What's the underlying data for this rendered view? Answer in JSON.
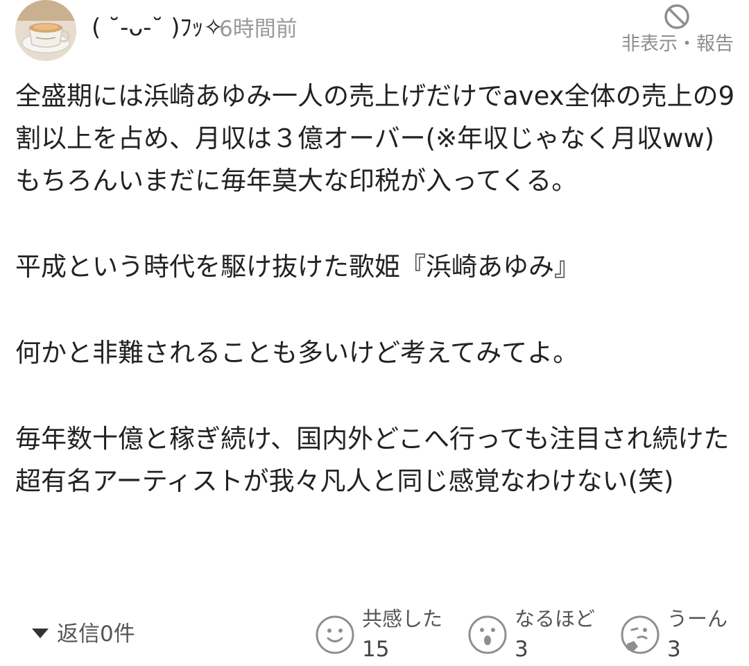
{
  "comment": {
    "user_name": "( ˘-ᴗ-˘ )ﾌｯ✧",
    "timestamp": "6時間前",
    "hide_report_label": "非表示・報告",
    "body_paragraphs": [
      "全盛期には浜崎あゆみ一人の売上げだけでavex全体の売上の9割以上を占め、月収は３億オーバー(※年収じゃなく月収ww) もちろんいまだに毎年莫大な印税が入ってくる。",
      "平成という時代を駆け抜けた歌姫『浜崎あゆみ』",
      "何かと非難されることも多いけど考えてみてよ。",
      "毎年数十億と稼ぎ続け、国内外どこへ行っても注目され続けた超有名アーティストが我々凡人と同じ感覚なわけない(笑)"
    ],
    "reply_label": "返信0件",
    "reactions": [
      {
        "label": "共感した",
        "count": "15",
        "icon": "smile-face-icon"
      },
      {
        "label": "なるほど",
        "count": "3",
        "icon": "surprised-face-icon"
      },
      {
        "label": "うーん",
        "count": "3",
        "icon": "thinking-face-icon"
      }
    ]
  },
  "colors": {
    "text": "#222222",
    "muted": "#9a9a9a",
    "icon_gray": "#8e8e8e"
  }
}
